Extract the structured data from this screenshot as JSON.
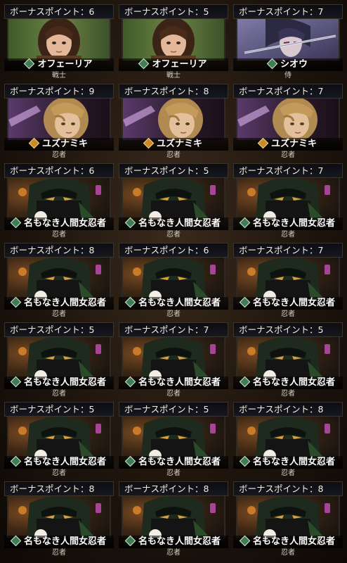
{
  "characters": [
    {
      "bonus_text": "ボーナスポイント：6",
      "name": "オフェーリア",
      "job": "戦士",
      "rank": "green",
      "portrait": "warrior-woman"
    },
    {
      "bonus_text": "ボーナスポイント：5",
      "name": "オフェーリア",
      "job": "戦士",
      "rank": "green",
      "portrait": "warrior-woman"
    },
    {
      "bonus_text": "ボーナスポイント：7",
      "name": "シオウ",
      "job": "侍",
      "rank": "green",
      "portrait": "samurai"
    },
    {
      "bonus_text": "ボーナスポイント：9",
      "name": "ユズナミキ",
      "job": "忍者",
      "rank": "gold",
      "portrait": "blonde-ninja"
    },
    {
      "bonus_text": "ボーナスポイント：8",
      "name": "ユズナミキ",
      "job": "忍者",
      "rank": "gold",
      "portrait": "blonde-ninja"
    },
    {
      "bonus_text": "ボーナスポイント：7",
      "name": "ユズナミキ",
      "job": "忍者",
      "rank": "gold",
      "portrait": "blonde-ninja"
    },
    {
      "bonus_text": "ボーナスポイント：6",
      "name": "名もなき人間女忍者",
      "job": "忍者",
      "rank": "green",
      "portrait": "masked-ninja"
    },
    {
      "bonus_text": "ボーナスポイント：5",
      "name": "名もなき人間女忍者",
      "job": "忍者",
      "rank": "green",
      "portrait": "masked-ninja"
    },
    {
      "bonus_text": "ボーナスポイント：7",
      "name": "名もなき人間女忍者",
      "job": "忍者",
      "rank": "green",
      "portrait": "masked-ninja"
    },
    {
      "bonus_text": "ボーナスポイント：8",
      "name": "名もなき人間女忍者",
      "job": "忍者",
      "rank": "green",
      "portrait": "masked-ninja"
    },
    {
      "bonus_text": "ボーナスポイント：6",
      "name": "名もなき人間女忍者",
      "job": "忍者",
      "rank": "green",
      "portrait": "masked-ninja"
    },
    {
      "bonus_text": "ボーナスポイント：7",
      "name": "名もなき人間女忍者",
      "job": "忍者",
      "rank": "green",
      "portrait": "masked-ninja"
    },
    {
      "bonus_text": "ボーナスポイント：5",
      "name": "名もなき人間女忍者",
      "job": "忍者",
      "rank": "green",
      "portrait": "masked-ninja"
    },
    {
      "bonus_text": "ボーナスポイント：7",
      "name": "名もなき人間女忍者",
      "job": "忍者",
      "rank": "green",
      "portrait": "masked-ninja"
    },
    {
      "bonus_text": "ボーナスポイント：5",
      "name": "名もなき人間女忍者",
      "job": "忍者",
      "rank": "green",
      "portrait": "masked-ninja"
    },
    {
      "bonus_text": "ボーナスポイント：5",
      "name": "名もなき人間女忍者",
      "job": "忍者",
      "rank": "green",
      "portrait": "masked-ninja"
    },
    {
      "bonus_text": "ボーナスポイント：5",
      "name": "名もなき人間女忍者",
      "job": "忍者",
      "rank": "green",
      "portrait": "masked-ninja"
    },
    {
      "bonus_text": "ボーナスポイント：8",
      "name": "名もなき人間女忍者",
      "job": "忍者",
      "rank": "green",
      "portrait": "masked-ninja"
    },
    {
      "bonus_text": "ボーナスポイント：8",
      "name": "名もなき人間女忍者",
      "job": "忍者",
      "rank": "green",
      "portrait": "masked-ninja"
    },
    {
      "bonus_text": "ボーナスポイント：8",
      "name": "名もなき人間女忍者",
      "job": "忍者",
      "rank": "green",
      "portrait": "masked-ninja"
    },
    {
      "bonus_text": "ボーナスポイント：8",
      "name": "名もなき人間女忍者",
      "job": "忍者",
      "rank": "green",
      "portrait": "masked-ninja"
    }
  ],
  "colors": {
    "rank_green": "#3f7d55",
    "rank_gold": "#c98a2a",
    "banner_bg": "#0c0c12",
    "text": "#f2ece0"
  }
}
